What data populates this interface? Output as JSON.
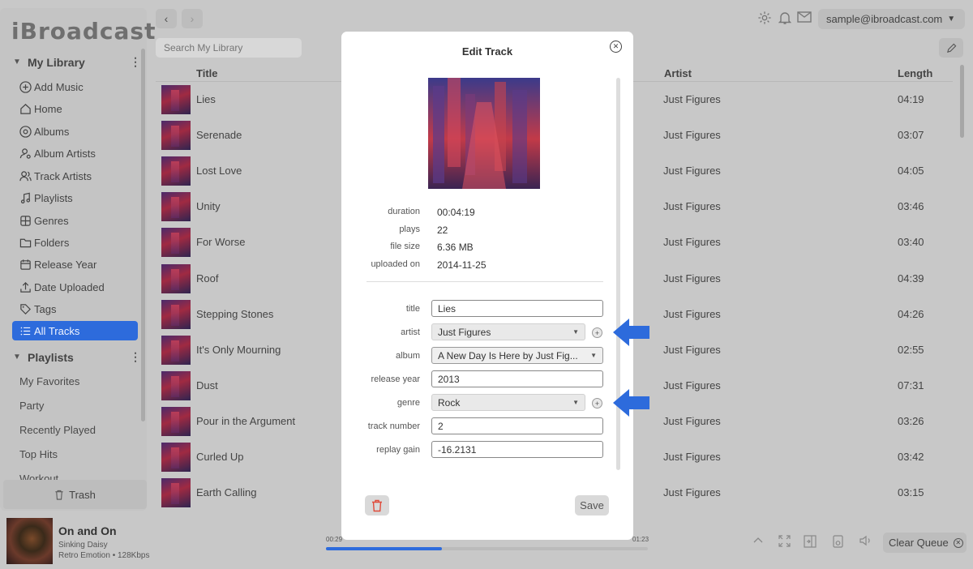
{
  "app": {
    "logo": "iBroadcast"
  },
  "sidebar": {
    "my_library": "My Library",
    "items": [
      {
        "label": "Add Music",
        "icon": "plus-circle-icon"
      },
      {
        "label": "Home",
        "icon": "home-icon"
      },
      {
        "label": "Albums",
        "icon": "disc-icon"
      },
      {
        "label": "Album Artists",
        "icon": "user-music-icon"
      },
      {
        "label": "Track Artists",
        "icon": "users-icon"
      },
      {
        "label": "Playlists",
        "icon": "music-note-icon"
      },
      {
        "label": "Genres",
        "icon": "grid-icon"
      },
      {
        "label": "Folders",
        "icon": "folder-icon"
      },
      {
        "label": "Release Year",
        "icon": "calendar-icon"
      },
      {
        "label": "Date Uploaded",
        "icon": "upload-icon"
      },
      {
        "label": "Tags",
        "icon": "tag-icon"
      },
      {
        "label": "All Tracks",
        "icon": "list-icon",
        "active": true
      }
    ],
    "playlists_heading": "Playlists",
    "playlists": [
      "My Favorites",
      "Party",
      "Recently Played",
      "Top Hits",
      "Workout"
    ],
    "trash": "Trash"
  },
  "header": {
    "account": "sample@ibroadcast.com",
    "search_placeholder": "Search My Library"
  },
  "table": {
    "columns": {
      "title": "Title",
      "artist": "Artist",
      "length": "Length"
    },
    "rows": [
      {
        "title": "Lies",
        "artist": "Just Figures",
        "length": "04:19"
      },
      {
        "title": "Serenade",
        "artist": "Just Figures",
        "length": "03:07"
      },
      {
        "title": "Lost Love",
        "artist": "Just Figures",
        "length": "04:05"
      },
      {
        "title": "Unity",
        "artist": "Just Figures",
        "length": "03:46"
      },
      {
        "title": "For Worse",
        "artist": "Just Figures",
        "length": "03:40"
      },
      {
        "title": "Roof",
        "artist": "Just Figures",
        "length": "04:39"
      },
      {
        "title": "Stepping Stones",
        "artist": "Just Figures",
        "length": "04:26"
      },
      {
        "title": "It's Only Mourning",
        "artist": "Just Figures",
        "length": "02:55"
      },
      {
        "title": "Dust",
        "artist": "Just Figures",
        "length": "07:31"
      },
      {
        "title": "Pour in the Argument",
        "artist": "Just Figures",
        "length": "03:26"
      },
      {
        "title": "Curled Up",
        "artist": "Just Figures",
        "length": "03:42"
      },
      {
        "title": "Earth Calling",
        "artist": "Just Figures",
        "length": "03:15"
      }
    ]
  },
  "player": {
    "title": "On and On",
    "artist": "Sinking Daisy",
    "album_info": "Retro Emotion • 128Kbps",
    "elapsed": "00:29",
    "total": "01:23",
    "progress": 0.36,
    "clear_queue": "Clear Queue"
  },
  "modal": {
    "title": "Edit Track",
    "info": [
      {
        "key": "duration",
        "value": "00:04:19"
      },
      {
        "key": "plays",
        "value": "22"
      },
      {
        "key": "file size",
        "value": "6.36 MB"
      },
      {
        "key": "uploaded on",
        "value": "2014-11-25"
      }
    ],
    "fields": {
      "title": {
        "label": "title",
        "value": "Lies"
      },
      "artist": {
        "label": "artist",
        "value": "Just Figures"
      },
      "album": {
        "label": "album",
        "value": "A New Day Is Here by Just Fig..."
      },
      "release_year": {
        "label": "release year",
        "value": "2013"
      },
      "genre": {
        "label": "genre",
        "value": "Rock"
      },
      "track_number": {
        "label": "track number",
        "value": "2"
      },
      "replay_gain": {
        "label": "replay gain",
        "value": "-16.2131"
      }
    },
    "save": "Save"
  },
  "colors": {
    "accent": "#2d6bdc",
    "callout_arrow": "#2d6bdc"
  }
}
